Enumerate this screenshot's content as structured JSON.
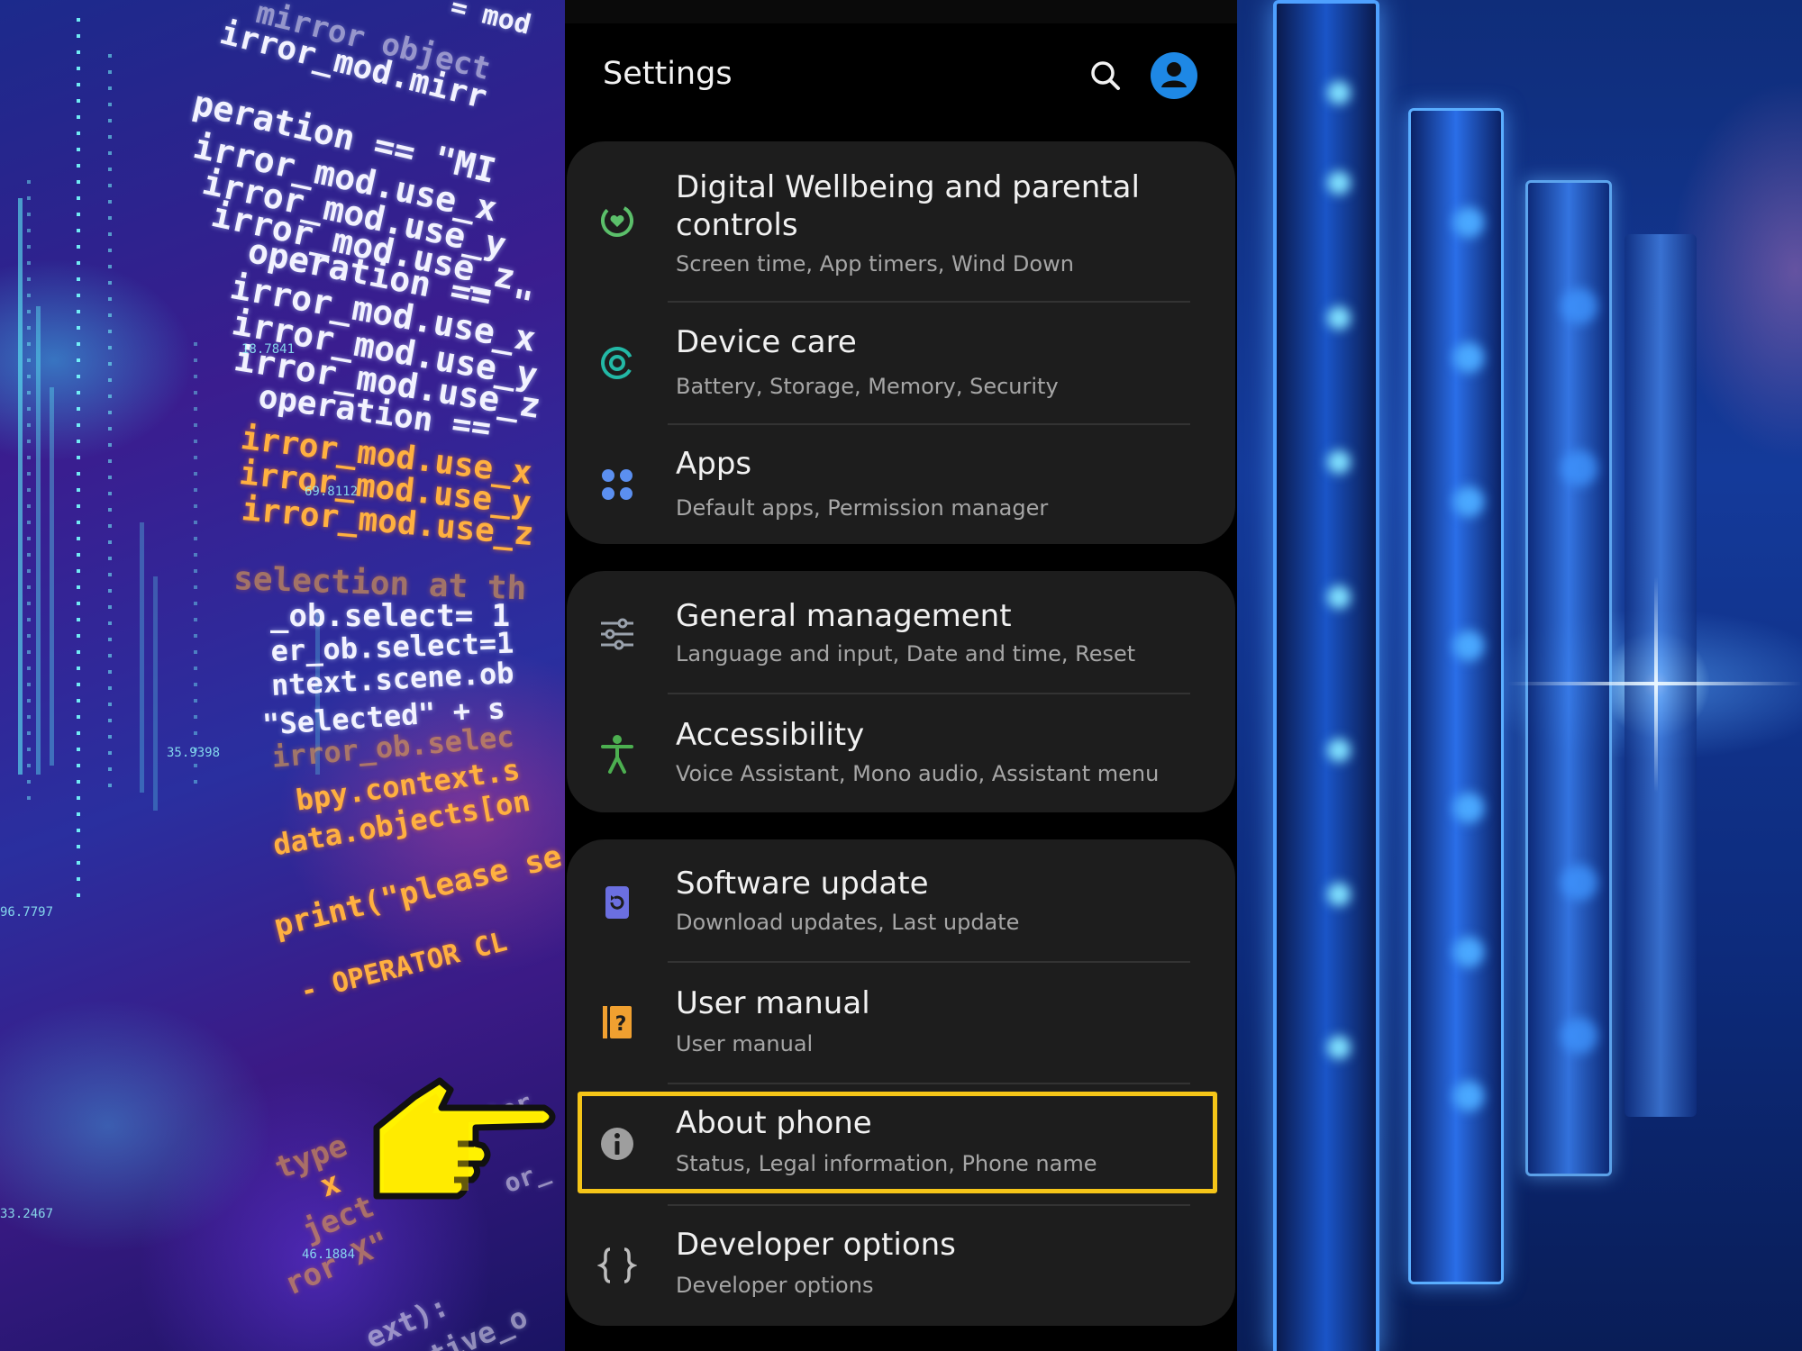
{
  "header": {
    "title": "Settings",
    "search_icon": "search-icon",
    "avatar_icon": "account-icon"
  },
  "groups": [
    {
      "items": [
        {
          "title": "Digital Wellbeing and parental controls",
          "title_line1": "Digital Wellbeing and parental",
          "title_line2": "controls",
          "subtitle": "Screen time, App timers, Wind Down",
          "icon": "digital-wellbeing-icon",
          "icon_color": "#5bbf6a"
        },
        {
          "title": "Device care",
          "subtitle": "Battery, Storage, Memory, Security",
          "icon": "device-care-icon",
          "icon_color": "#23b8a6"
        },
        {
          "title": "Apps",
          "subtitle": "Default apps, Permission manager",
          "icon": "apps-icon",
          "icon_color": "#5b8ff0"
        }
      ]
    },
    {
      "items": [
        {
          "title": "General management",
          "subtitle": "Language and input, Date and time, Reset",
          "icon": "general-management-icon",
          "icon_color": "#9aa2ad"
        },
        {
          "title": "Accessibility",
          "subtitle": "Voice Assistant, Mono audio, Assistant menu",
          "icon": "accessibility-icon",
          "icon_color": "#4caf50"
        }
      ]
    },
    {
      "items": [
        {
          "title": "Software update",
          "subtitle": "Download updates, Last update",
          "icon": "software-update-icon",
          "icon_color": "#6b6fe0"
        },
        {
          "title": "User manual",
          "subtitle": "User manual",
          "icon": "user-manual-icon",
          "icon_color": "#f0a030"
        },
        {
          "title": "About phone",
          "subtitle": "Status, Legal information, Phone name",
          "icon": "info-icon",
          "icon_color": "#9e9e9e",
          "highlighted": true
        },
        {
          "title": "Developer options",
          "subtitle": "Developer options",
          "icon": "developer-options-icon",
          "icon_color": "#bdbdbd"
        }
      ]
    }
  ],
  "annotation": {
    "highlight_color": "#f5c518",
    "pointer": "pointing-hand-icon"
  },
  "background": {
    "left_code": [
      "mirror object",
      "irror_mod.mirr",
      "peration == \"MI",
      "irror_mod.use_x",
      "irror_mod.use_y",
      "irror_mod.use_z",
      "operation == \"",
      "irror_mod.use_x",
      "irror_mod.use_y",
      "irror_mod.use_z",
      "operation ==",
      "irror_mod.use_x",
      "irror_mod.use_y",
      "irror_mod.use_z",
      "selection at th",
      "_ob.select= 1",
      "er_ob.select=1",
      "ntext.scene.ob",
      "\"Selected\" + s",
      "irror_ob.selec",
      "bpy.context.s",
      "data.objects[on",
      "print(\"please se",
      "- OPERATOR CL",
      "type",
      "x",
      "ject",
      "ror X\"",
      "ext):",
      "tive_o",
      "ator",
      "or_",
      "= mod"
    ],
    "left_numbers": [
      "18.7841",
      "69.8112",
      "35.9398",
      "96.7797",
      "33.2467",
      "46.1884"
    ]
  }
}
